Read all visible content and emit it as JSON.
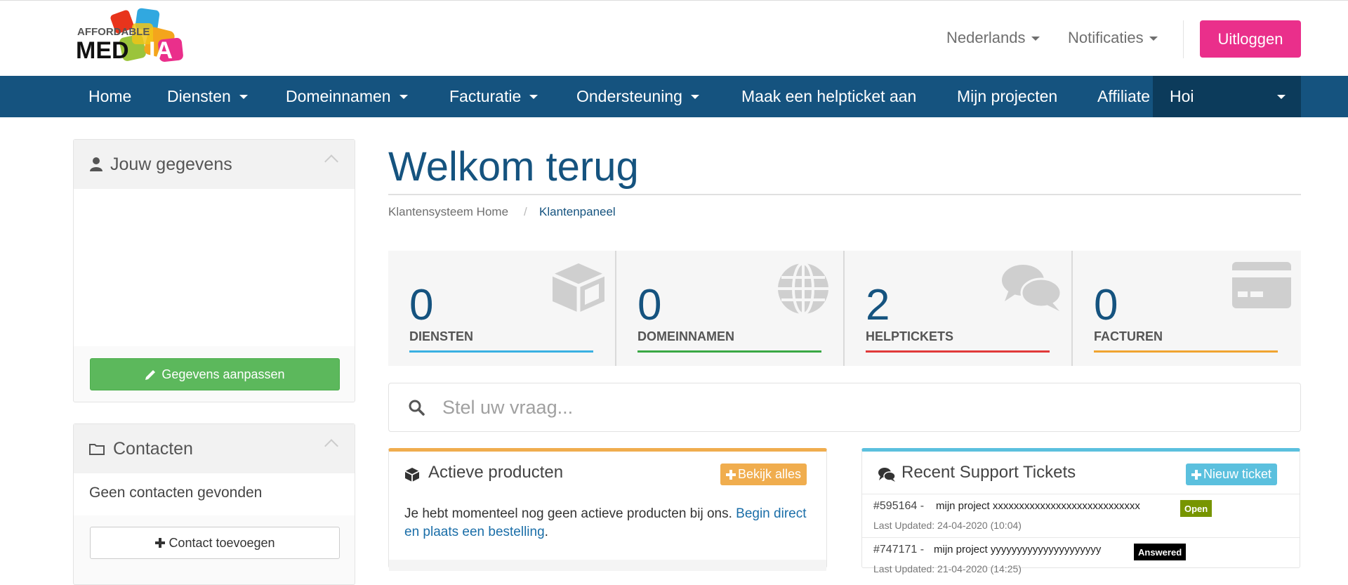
{
  "brand": {
    "logo_top": "AFFORDABLE",
    "logo_bottom_left": "MED",
    "logo_bottom_right": "IA"
  },
  "header": {
    "language": "Nederlands",
    "notifications": "Notificaties",
    "logout": "Uitloggen"
  },
  "nav": {
    "items": [
      {
        "label": "Home"
      },
      {
        "label": "Diensten"
      },
      {
        "label": "Domeinnamen"
      },
      {
        "label": "Facturatie"
      },
      {
        "label": "Ondersteuning"
      },
      {
        "label": "Maak een helpticket aan"
      },
      {
        "label": "Mijn projecten"
      },
      {
        "label": "Affiliate"
      }
    ],
    "user_greeting": "Hoi"
  },
  "sidebar": {
    "details_title": "Jouw gegevens",
    "edit_button": "Gegevens aanpassen",
    "contacts_title": "Contacten",
    "no_contacts": "Geen contacten gevonden",
    "add_contact_button": "Contact toevoegen"
  },
  "main": {
    "title": "Welkom terug",
    "breadcrumb_home": "Klantensysteem Home",
    "breadcrumb_sep": "/",
    "breadcrumb_active": "Klantenpaneel",
    "stats": [
      {
        "value": "0",
        "label": "DIENSTEN",
        "color": "#3ab0e2",
        "icon": "cube-icon"
      },
      {
        "value": "0",
        "label": "DOMEINNAMEN",
        "color": "#3aa845",
        "icon": "globe-icon"
      },
      {
        "value": "2",
        "label": "HELPTICKETS",
        "color": "#e03a3a",
        "icon": "comments-icon"
      },
      {
        "value": "0",
        "label": "FACTUREN",
        "color": "#f0a431",
        "icon": "credit-card-icon"
      }
    ],
    "search_placeholder": "Stel uw vraag..."
  },
  "products": {
    "title": "Actieve producten",
    "button": "Bekijk alles",
    "text": "Je hebt momenteel nog geen actieve producten bij ons. ",
    "link": "Begin direct en plaats een bestelling",
    "text_end": ".",
    "accent": "#f0ad4e"
  },
  "tickets": {
    "title": "Recent Support Tickets",
    "button": "Nieuw ticket",
    "accent": "#5bc0de",
    "items": [
      {
        "id": "#595164 -",
        "subject": "mijn project xxxxxxxxxxxxxxxxxxxxxxxxxxxx",
        "status": "Open",
        "status_color": "#779500",
        "updated": "Last Updated: 24-04-2020 (10:04)"
      },
      {
        "id": "#747171 -",
        "subject": "mijn project yyyyyyyyyyyyyyyyyyyyy",
        "status": "Answered",
        "status_color": "#000000",
        "updated": "Last Updated: 21-04-2020 (14:25)"
      }
    ]
  }
}
